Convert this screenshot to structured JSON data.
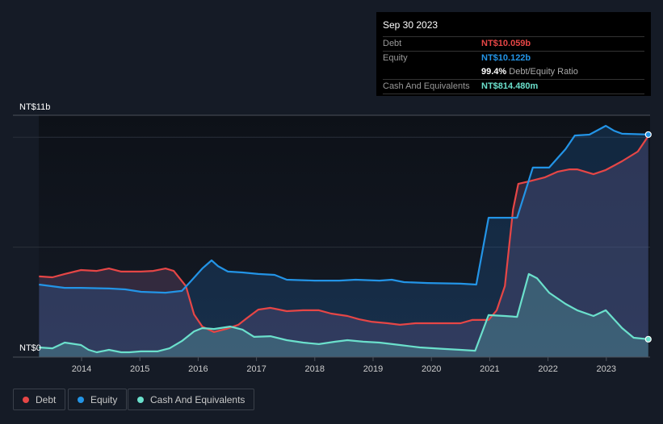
{
  "tooltip": {
    "date": "Sep 30 2023",
    "debt_label": "Debt",
    "debt_value": "NT$10.059b",
    "equity_label": "Equity",
    "equity_value": "NT$10.122b",
    "ratio_value": "99.4%",
    "ratio_label": "Debt/Equity Ratio",
    "cash_label": "Cash And Equivalents",
    "cash_value": "NT$814.480m"
  },
  "legend": [
    {
      "label": "Debt",
      "color": "#e64646"
    },
    {
      "label": "Equity",
      "color": "#2394e6"
    },
    {
      "label": "Cash And Equivalents",
      "color": "#6be0cc"
    }
  ],
  "chart_data": {
    "type": "area",
    "y_top_label": "NT$11b",
    "y_bottom_label": "NT$0",
    "ylim": [
      0,
      11
    ],
    "xlim": [
      2012.55,
      2023.75
    ],
    "gridlines": [
      5,
      10,
      11
    ],
    "x_ticks": [
      "2014",
      "2015",
      "2016",
      "2017",
      "2018",
      "2019",
      "2020",
      "2021",
      "2022",
      "2023"
    ],
    "legend_position": "bottom-left",
    "series": [
      {
        "name": "Debt",
        "color": "#e64646",
        "points": [
          [
            2013.27,
            3.67
          ],
          [
            2013.5,
            3.63
          ],
          [
            2013.71,
            3.78
          ],
          [
            2013.99,
            3.96
          ],
          [
            2014.26,
            3.92
          ],
          [
            2014.47,
            4.03
          ],
          [
            2014.68,
            3.89
          ],
          [
            2015.02,
            3.89
          ],
          [
            2015.23,
            3.92
          ],
          [
            2015.44,
            4.03
          ],
          [
            2015.58,
            3.92
          ],
          [
            2015.79,
            3.23
          ],
          [
            2015.93,
            1.94
          ],
          [
            2016.07,
            1.39
          ],
          [
            2016.27,
            1.14
          ],
          [
            2016.48,
            1.28
          ],
          [
            2016.69,
            1.47
          ],
          [
            2016.83,
            1.76
          ],
          [
            2017.03,
            2.16
          ],
          [
            2017.24,
            2.24
          ],
          [
            2017.52,
            2.09
          ],
          [
            2017.8,
            2.13
          ],
          [
            2018.07,
            2.13
          ],
          [
            2018.28,
            1.98
          ],
          [
            2018.56,
            1.87
          ],
          [
            2018.76,
            1.72
          ],
          [
            2018.97,
            1.61
          ],
          [
            2019.25,
            1.54
          ],
          [
            2019.46,
            1.47
          ],
          [
            2019.73,
            1.54
          ],
          [
            2020.08,
            1.54
          ],
          [
            2020.5,
            1.54
          ],
          [
            2020.7,
            1.69
          ],
          [
            2020.98,
            1.69
          ],
          [
            2021.12,
            2.13
          ],
          [
            2021.26,
            3.23
          ],
          [
            2021.4,
            6.71
          ],
          [
            2021.49,
            7.88
          ],
          [
            2021.67,
            7.99
          ],
          [
            2021.95,
            8.18
          ],
          [
            2022.16,
            8.43
          ],
          [
            2022.37,
            8.54
          ],
          [
            2022.5,
            8.54
          ],
          [
            2022.78,
            8.32
          ],
          [
            2022.99,
            8.51
          ],
          [
            2023.27,
            8.91
          ],
          [
            2023.54,
            9.35
          ],
          [
            2023.72,
            10.059
          ]
        ]
      },
      {
        "name": "Equity",
        "color": "#2394e6",
        "points": [
          [
            2013.27,
            3.3
          ],
          [
            2013.71,
            3.15
          ],
          [
            2013.99,
            3.15
          ],
          [
            2014.47,
            3.12
          ],
          [
            2014.75,
            3.08
          ],
          [
            2015.02,
            2.97
          ],
          [
            2015.44,
            2.93
          ],
          [
            2015.72,
            3.01
          ],
          [
            2015.86,
            3.41
          ],
          [
            2016.07,
            4.03
          ],
          [
            2016.23,
            4.4
          ],
          [
            2016.34,
            4.14
          ],
          [
            2016.51,
            3.89
          ],
          [
            2016.76,
            3.85
          ],
          [
            2017.03,
            3.78
          ],
          [
            2017.31,
            3.74
          ],
          [
            2017.52,
            3.52
          ],
          [
            2018.0,
            3.48
          ],
          [
            2018.42,
            3.48
          ],
          [
            2018.7,
            3.52
          ],
          [
            2019.11,
            3.48
          ],
          [
            2019.32,
            3.52
          ],
          [
            2019.53,
            3.41
          ],
          [
            2019.94,
            3.37
          ],
          [
            2020.5,
            3.34
          ],
          [
            2020.77,
            3.3
          ],
          [
            2020.98,
            6.34
          ],
          [
            2021.47,
            6.34
          ],
          [
            2021.74,
            8.62
          ],
          [
            2022.02,
            8.62
          ],
          [
            2022.3,
            9.46
          ],
          [
            2022.46,
            10.08
          ],
          [
            2022.71,
            10.12
          ],
          [
            2022.99,
            10.52
          ],
          [
            2023.13,
            10.3
          ],
          [
            2023.27,
            10.16
          ],
          [
            2023.72,
            10.122
          ]
        ]
      },
      {
        "name": "Cash And Equivalents",
        "color": "#6be0cc",
        "points": [
          [
            2013.27,
            0.44
          ],
          [
            2013.5,
            0.4
          ],
          [
            2013.71,
            0.66
          ],
          [
            2013.99,
            0.55
          ],
          [
            2014.12,
            0.33
          ],
          [
            2014.26,
            0.22
          ],
          [
            2014.47,
            0.33
          ],
          [
            2014.68,
            0.22
          ],
          [
            2014.82,
            0.22
          ],
          [
            2015.02,
            0.26
          ],
          [
            2015.3,
            0.26
          ],
          [
            2015.51,
            0.4
          ],
          [
            2015.72,
            0.73
          ],
          [
            2015.93,
            1.17
          ],
          [
            2016.07,
            1.32
          ],
          [
            2016.27,
            1.28
          ],
          [
            2016.55,
            1.39
          ],
          [
            2016.76,
            1.25
          ],
          [
            2016.96,
            0.92
          ],
          [
            2017.24,
            0.95
          ],
          [
            2017.52,
            0.77
          ],
          [
            2017.8,
            0.66
          ],
          [
            2018.07,
            0.59
          ],
          [
            2018.35,
            0.7
          ],
          [
            2018.56,
            0.77
          ],
          [
            2018.83,
            0.7
          ],
          [
            2019.11,
            0.66
          ],
          [
            2019.46,
            0.55
          ],
          [
            2019.8,
            0.44
          ],
          [
            2020.22,
            0.37
          ],
          [
            2020.5,
            0.33
          ],
          [
            2020.75,
            0.29
          ],
          [
            2020.98,
            1.91
          ],
          [
            2021.26,
            1.87
          ],
          [
            2021.47,
            1.83
          ],
          [
            2021.67,
            3.78
          ],
          [
            2021.81,
            3.59
          ],
          [
            2022.02,
            2.93
          ],
          [
            2022.3,
            2.42
          ],
          [
            2022.5,
            2.13
          ],
          [
            2022.78,
            1.87
          ],
          [
            2022.99,
            2.13
          ],
          [
            2023.27,
            1.32
          ],
          [
            2023.47,
            0.88
          ],
          [
            2023.72,
            0.814
          ]
        ]
      }
    ]
  }
}
